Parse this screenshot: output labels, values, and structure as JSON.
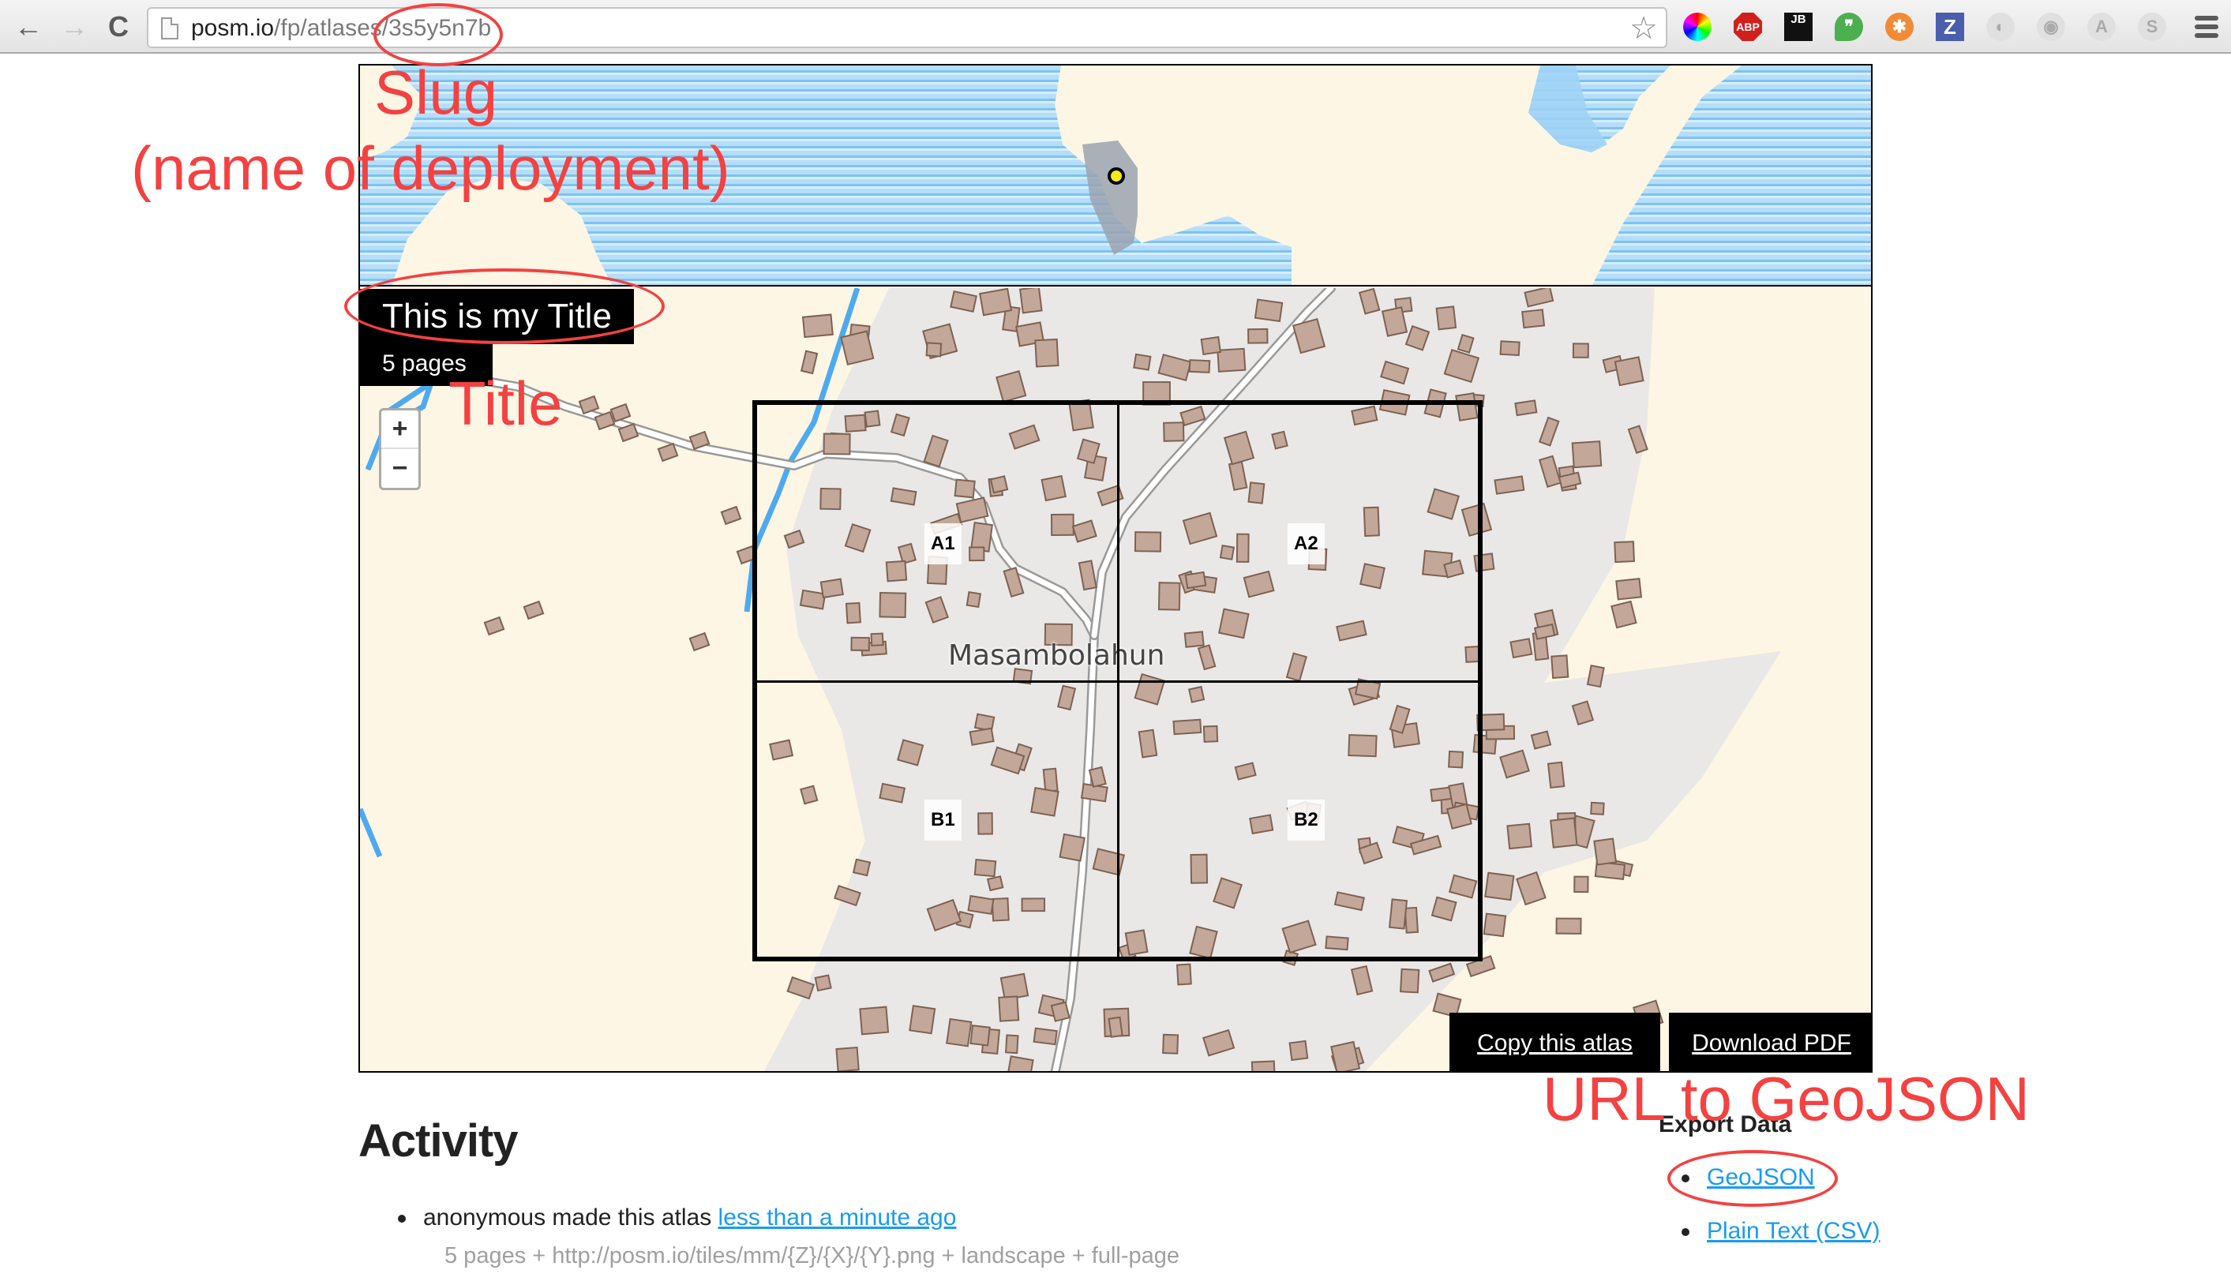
{
  "browser": {
    "url_host": "posm.io",
    "url_path": "/fp/atlases/3s5y5n7b",
    "nav": {
      "back": "←",
      "forward": "→",
      "reload": "C"
    },
    "bookmark_icon": "star-icon",
    "extensions": [
      {
        "name": "color-picker-icon",
        "glyph": ""
      },
      {
        "name": "adblock-plus-icon",
        "glyph": "ABP"
      },
      {
        "name": "jetbrains-icon",
        "glyph": "JB"
      },
      {
        "name": "hangouts-icon",
        "glyph": "❞"
      },
      {
        "name": "orange-extension-icon",
        "glyph": "✱"
      },
      {
        "name": "z-extension-icon",
        "glyph": "Z"
      },
      {
        "name": "grey-extension-1-icon",
        "glyph": "◐"
      },
      {
        "name": "grey-extension-2-icon",
        "glyph": "◉"
      },
      {
        "name": "angular-icon",
        "glyph": "A"
      },
      {
        "name": "skype-icon",
        "glyph": "S"
      }
    ]
  },
  "atlas": {
    "title": "This is my Title",
    "pages_label": "5 pages",
    "place_name": "Masambolahun",
    "zoom_in": "+",
    "zoom_out": "−",
    "grid_cells": [
      "A1",
      "A2",
      "B1",
      "B2"
    ],
    "copy_button": "Copy this atlas",
    "download_button": "Download PDF"
  },
  "activity": {
    "heading": "Activity",
    "items": [
      {
        "actor_text": "anonymous made this atlas ",
        "time_link": "less than a minute ago",
        "details": "5 pages + http://posm.io/tiles/mm/{Z}/{X}/{Y}.png + landscape + full-page"
      }
    ]
  },
  "export": {
    "heading": "Export Data",
    "links": [
      "GeoJSON",
      "Plain Text (CSV)"
    ]
  },
  "annotations": {
    "slug": "Slug",
    "slug_sub": "(name of deployment)",
    "title": "Title",
    "geojson": "URL to GeoJSON",
    "color": "#f44141"
  },
  "colors": {
    "land": "#fdf6e4",
    "water": "#9fd3f5",
    "settlement": "#e9e8e6",
    "building": "#c3a89a",
    "river": "#4eaaf0",
    "link": "#1a9bf0"
  }
}
